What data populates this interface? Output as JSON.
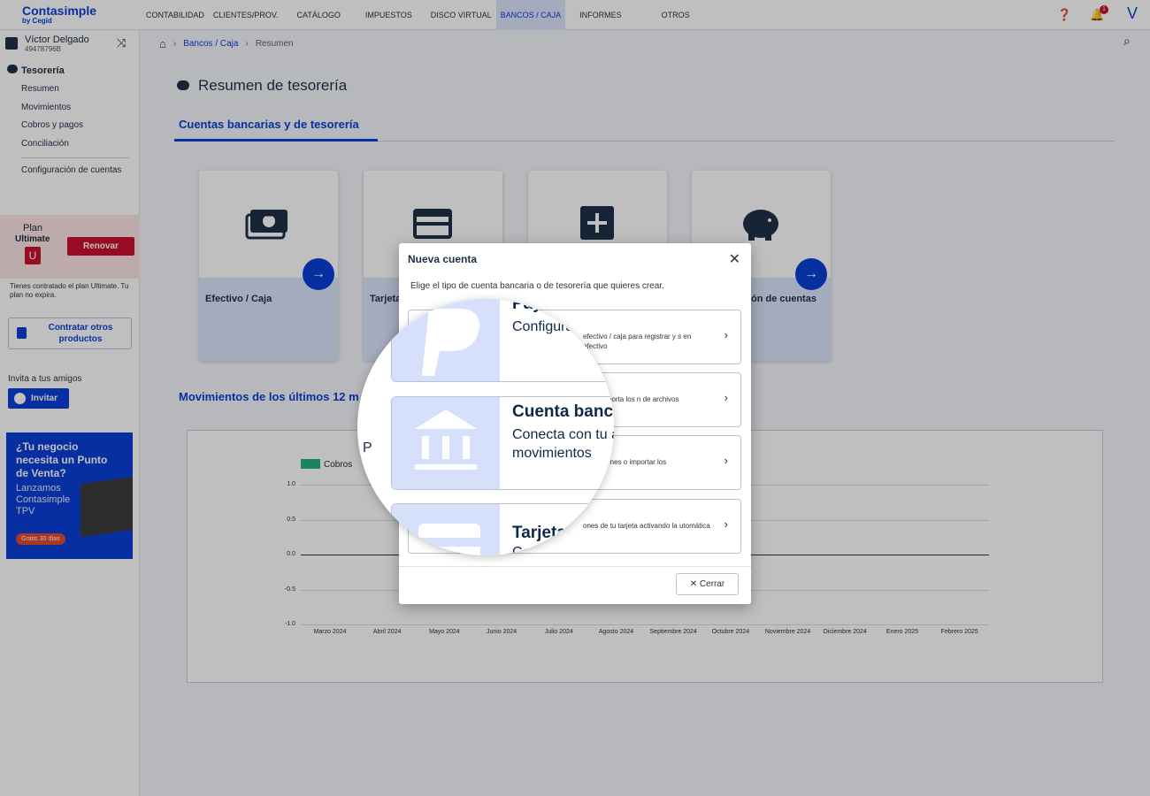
{
  "topbar": {
    "logo": "Contasimple",
    "logo_sub": "by Cegid",
    "nav": [
      "CONTABILIDAD",
      "CLIENTES/PROV.",
      "CATÁLOGO",
      "IMPUESTOS",
      "DISCO VIRTUAL",
      "BANCOS / CAJA",
      "INFORMES",
      "OTROS"
    ],
    "active_nav": "BANCOS / CAJA",
    "notification_count": "1",
    "user_initial": "V"
  },
  "sidebar": {
    "user_name": "Víctor Delgado",
    "user_id": "49478796B",
    "section_title": "Tesorería",
    "items": [
      "Resumen",
      "Movimientos",
      "Cobros y pagos",
      "Conciliación",
      "Configuración de cuentas"
    ],
    "plan_label": "Plan",
    "plan_name": "Ultimate",
    "plan_badge": "U",
    "renew_label": "Renovar",
    "plan_note": "Tienes contratado el plan Ultimate. Tu plan no expira.",
    "hire_label": "Contratar otros productos",
    "invite_caption": "Invita a tus amigos",
    "invite_label": "Invitar",
    "promo_title": "¿Tu negocio necesita un Punto de Venta?",
    "promo_text": "Lanzamos Contasimple TPV",
    "promo_pill": "Gratis 30 días"
  },
  "breadcrumb": [
    "Bancos / Caja",
    "Resumen"
  ],
  "main": {
    "title": "Resumen de tesorería",
    "accounts_section": "Cuentas bancarias y de tesorería",
    "cards": [
      "Efectivo / Caja",
      "Tarjeta",
      "",
      "ón de cuentas"
    ],
    "movements_section": "Movimientos de los últimos 12 m"
  },
  "chart_data": {
    "type": "line",
    "series": [
      {
        "name": "Cobros",
        "values": [
          0,
          0,
          0,
          0,
          0,
          0,
          0,
          0,
          0,
          0,
          0,
          0
        ]
      }
    ],
    "categories": [
      "Marzo 2024",
      "Abril 2024",
      "Mayo 2024",
      "Junio 2024",
      "Julio 2024",
      "Agosto 2024",
      "Septiembre 2024",
      "Octubre 2024",
      "Noviembre 2024",
      "Diciembre 2024",
      "Enero 2025",
      "Febrero 2025"
    ],
    "y_ticks": [
      "1.0",
      "0.5",
      "0.0",
      "-0.5",
      "-1.0"
    ],
    "ylim": [
      -1.0,
      1.0
    ],
    "colors": {
      "Cobros": "#20b27a"
    }
  },
  "modal": {
    "title": "Nueva cuenta",
    "intro": "Elige el tipo de cuenta bancaria o de tesorería que quieres crear.",
    "options": [
      {
        "desc": "efectivo / caja para registrar y s en efectivo"
      },
      {
        "desc": "ual e importa los n de archivos"
      },
      {
        "desc": "cronizar nes o importar los"
      },
      {
        "desc": "ones de tu tarjeta activando la utomática"
      }
    ],
    "close_label": "Cerrar"
  },
  "magnifier": {
    "rows": [
      {
        "title": "Payp",
        "desc": "Configura movimiento"
      },
      {
        "title": "Cuenta banca",
        "desc": "Conecta con tu automáticame movimientos"
      },
      {
        "title": "Tarjeta",
        "desc": "Co"
      }
    ],
    "side_letter": "P"
  }
}
